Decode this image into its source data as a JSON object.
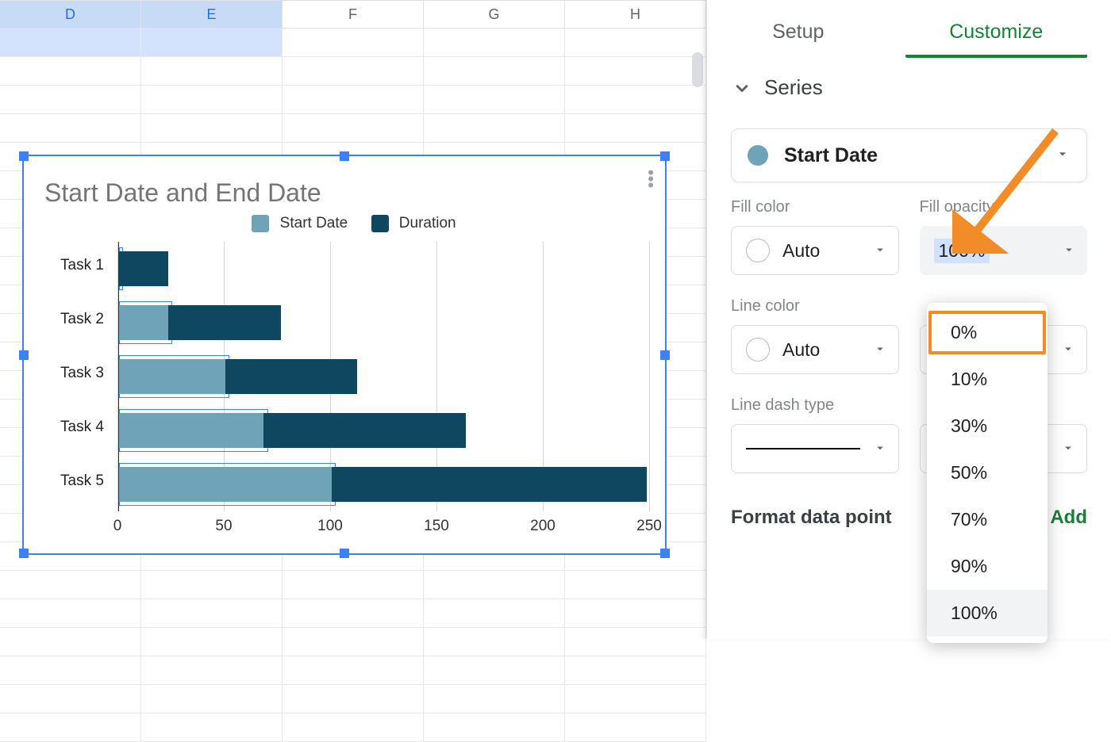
{
  "grid": {
    "columns": [
      "D",
      "E",
      "F",
      "G",
      "H"
    ],
    "selected": [
      "D",
      "E"
    ]
  },
  "chart_data": {
    "type": "bar",
    "orientation": "horizontal",
    "title": "Start Date and End Date",
    "categories": [
      "Task 1",
      "Task 2",
      "Task 3",
      "Task 4",
      "Task 5"
    ],
    "series": [
      {
        "name": "Start Date",
        "color": "#6fa3b8",
        "values": [
          0,
          23,
          50,
          68,
          100
        ]
      },
      {
        "name": "Duration",
        "color": "#0f4761",
        "values": [
          23,
          53,
          62,
          95,
          148
        ]
      }
    ],
    "x_ticks": [
      0,
      50,
      100,
      150,
      200,
      250
    ],
    "xlim": [
      0,
      250
    ]
  },
  "panel": {
    "tabs": {
      "setup": "Setup",
      "customize": "Customize",
      "active": "customize"
    },
    "section_label": "Series",
    "series_selected": "Start Date",
    "fill_color": {
      "label": "Fill color",
      "value": "Auto"
    },
    "fill_opacity": {
      "label": "Fill opacity",
      "value": "100%",
      "options": [
        "0%",
        "10%",
        "30%",
        "50%",
        "70%",
        "90%",
        "100%"
      ],
      "highlighted": "0%"
    },
    "line_color": {
      "label": "Line color",
      "value": "Auto"
    },
    "line_dash": {
      "label": "Line dash type"
    },
    "format_label": "Format data point",
    "add_label": "Add"
  }
}
